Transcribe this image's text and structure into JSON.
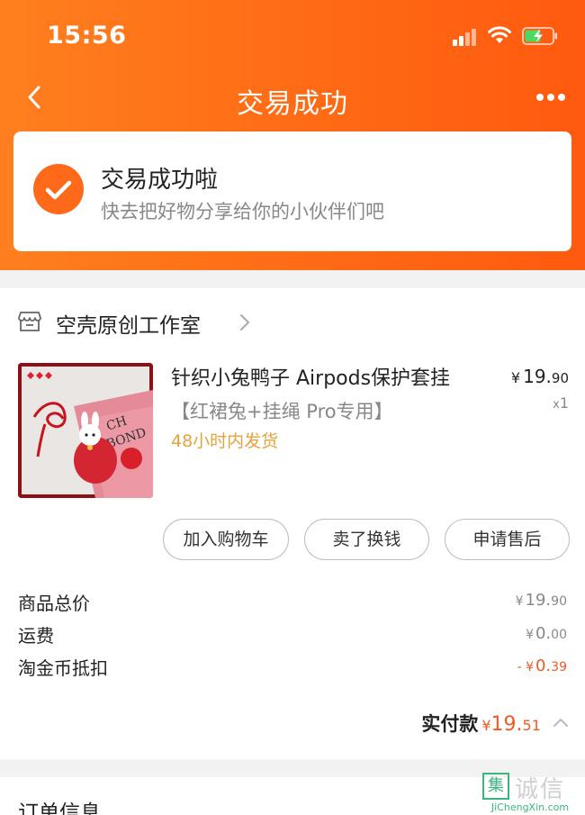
{
  "status_bar": {
    "time": "15:56"
  },
  "nav": {
    "title": "交易成功"
  },
  "success": {
    "title": "交易成功啦",
    "subtitle": "快去把好物分享给你的小伙伴们吧"
  },
  "shop": {
    "name": "空壳原创工作室"
  },
  "product": {
    "title": "针织小兔鸭子 Airpods保护套挂",
    "sku": "【红裙兔+挂绳 Pro专用】",
    "shipping": "48小时内发货",
    "price_symbol": "¥",
    "price_int": "19.",
    "price_dec": "90",
    "qty_prefix": "x",
    "qty": "1"
  },
  "actions": {
    "add_cart": "加入购物车",
    "sell": "卖了换钱",
    "after_sale": "申请售后"
  },
  "summary": {
    "goods_total_label": "商品总价",
    "goods_total_yen": "¥",
    "goods_total_int": "19.",
    "goods_total_dec": "90",
    "shipping_label": "运费",
    "shipping_yen": "¥",
    "shipping_int": "0.",
    "shipping_dec": "00",
    "coin_label": "淘金币抵扣",
    "coin_yen": "- ¥",
    "coin_int": "0.",
    "coin_dec": "39",
    "paid_label": "实付款",
    "paid_yen": "¥",
    "paid_int": "19.",
    "paid_dec": "51"
  },
  "order_info": {
    "title": "订单信息"
  },
  "watermark": {
    "icon": "集",
    "text": "诚信",
    "url": "JiChengXin.com"
  },
  "colors": {
    "accent": "#ff6a14",
    "price_red": "#f05a23",
    "ship_gold": "#e8a23b"
  }
}
